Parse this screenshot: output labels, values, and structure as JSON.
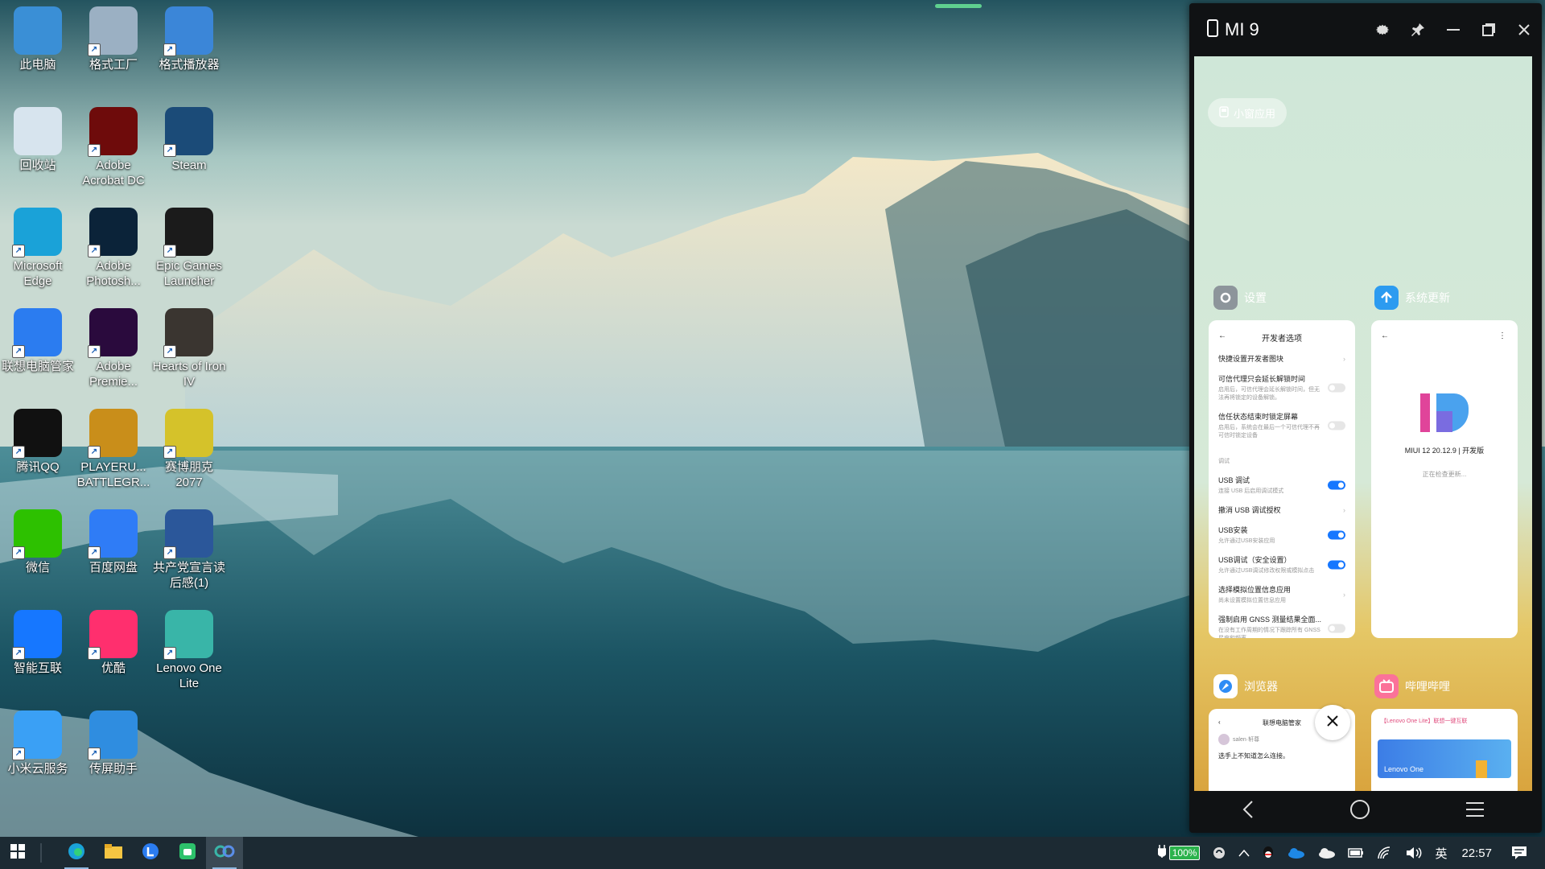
{
  "desktop": {
    "icons": [
      {
        "label": "此电脑",
        "icon": "computer-icon",
        "color": "#3a8fd6"
      },
      {
        "label": "格式工厂",
        "icon": "format-factory-icon",
        "color": "#9bb0c3"
      },
      {
        "label": "格式播放器",
        "icon": "format-player-icon",
        "color": "#3b86d8"
      },
      {
        "label": "回收站",
        "icon": "recycle-bin-icon",
        "color": "#d7e4ee"
      },
      {
        "label": "Adobe Acrobat DC",
        "icon": "acrobat-icon",
        "color": "#6e0b0b"
      },
      {
        "label": "Steam",
        "icon": "steam-icon",
        "color": "#1b4b78"
      },
      {
        "label": "Microsoft Edge",
        "icon": "edge-icon",
        "color": "#1aa2d8"
      },
      {
        "label": "Adobe Photosh...",
        "icon": "photoshop-icon",
        "color": "#0b2339"
      },
      {
        "label": "Epic Games Launcher",
        "icon": "epic-games-icon",
        "color": "#1b1b1b"
      },
      {
        "label": "联想电脑管家",
        "icon": "lenovo-manager-icon",
        "color": "#2b7cf0"
      },
      {
        "label": "Adobe Premie...",
        "icon": "premiere-icon",
        "color": "#2a0a3d"
      },
      {
        "label": "Hearts of Iron IV",
        "icon": "hearts-of-iron-icon",
        "color": "#3a3530"
      },
      {
        "label": "腾讯QQ",
        "icon": "qq-icon",
        "color": "#111111"
      },
      {
        "label": "PLAYERU... BATTLEGR...",
        "icon": "pubg-icon",
        "color": "#c98e1a"
      },
      {
        "label": "赛博朋克 2077",
        "icon": "cyberpunk-icon",
        "color": "#d5c22a"
      },
      {
        "label": "微信",
        "icon": "wechat-icon",
        "color": "#2dc100"
      },
      {
        "label": "百度网盘",
        "icon": "baidu-netdisk-icon",
        "color": "#2f7cf6"
      },
      {
        "label": "共产党宣言读后感(1)",
        "icon": "word-document-icon",
        "color": "#2b579a"
      },
      {
        "label": "智能互联",
        "icon": "smart-connect-icon",
        "color": "#1677ff"
      },
      {
        "label": "优酷",
        "icon": "youku-icon",
        "color": "#ff2f6e"
      },
      {
        "label": "Lenovo One Lite",
        "icon": "lenovo-one-icon",
        "color": "#39b5a8"
      },
      {
        "label": "小米云服务",
        "icon": "mi-cloud-icon",
        "color": "#3aa0f5"
      },
      {
        "label": "传屏助手",
        "icon": "screen-cast-icon",
        "color": "#2f8de0"
      }
    ]
  },
  "phone": {
    "title": "MI 9",
    "pill": "小窗应用",
    "apps": {
      "settings": {
        "name": "设置",
        "header": "开发者选项",
        "rows": [
          {
            "title": "快捷设置开发者图块",
            "sub": ""
          },
          {
            "title": "可信代理只会延长解锁时间",
            "sub": "启用后，可信代理会延长解锁时间，但无法再将锁定的设备解锁。"
          },
          {
            "title": "信任状态结束时锁定屏幕",
            "sub": "启用后，系统会在最后一个可信代理不再可信时锁定设备"
          },
          {
            "title": "调试",
            "sub": ""
          },
          {
            "title": "USB 调试",
            "sub": "连接 USB 后启用调试模式"
          },
          {
            "title": "撤消 USB 调试授权",
            "sub": ""
          },
          {
            "title": "USB安装",
            "sub": "允许通过USB安装应用"
          },
          {
            "title": "USB调试（安全设置）",
            "sub": "允许通过USB调试修改权限或模拟点击"
          },
          {
            "title": "选择模拟位置信息应用",
            "sub": "尚未设置模拟位置信息应用"
          },
          {
            "title": "强制启用 GNSS 测量结果全面...",
            "sub": "在没有工作周期的情况下跟踪所有 GNSS 星座和频率"
          }
        ]
      },
      "update": {
        "name": "系统更新",
        "version": "MIUI 12 20.12.9 | 开发版",
        "status": "正在检查更新..."
      },
      "browser": {
        "name": "浏览器",
        "header": "联想电脑管家",
        "user": "salen·轩尊",
        "text": "选手上不知道怎么连接。"
      },
      "bilibili": {
        "name": "哔哩哔哩",
        "snippet": "【Lenovo One Lite】联想一键互联",
        "banner": "Lenovo One"
      }
    }
  },
  "taskbar": {
    "battery": "100%",
    "ime": "英",
    "time": "22:57"
  }
}
